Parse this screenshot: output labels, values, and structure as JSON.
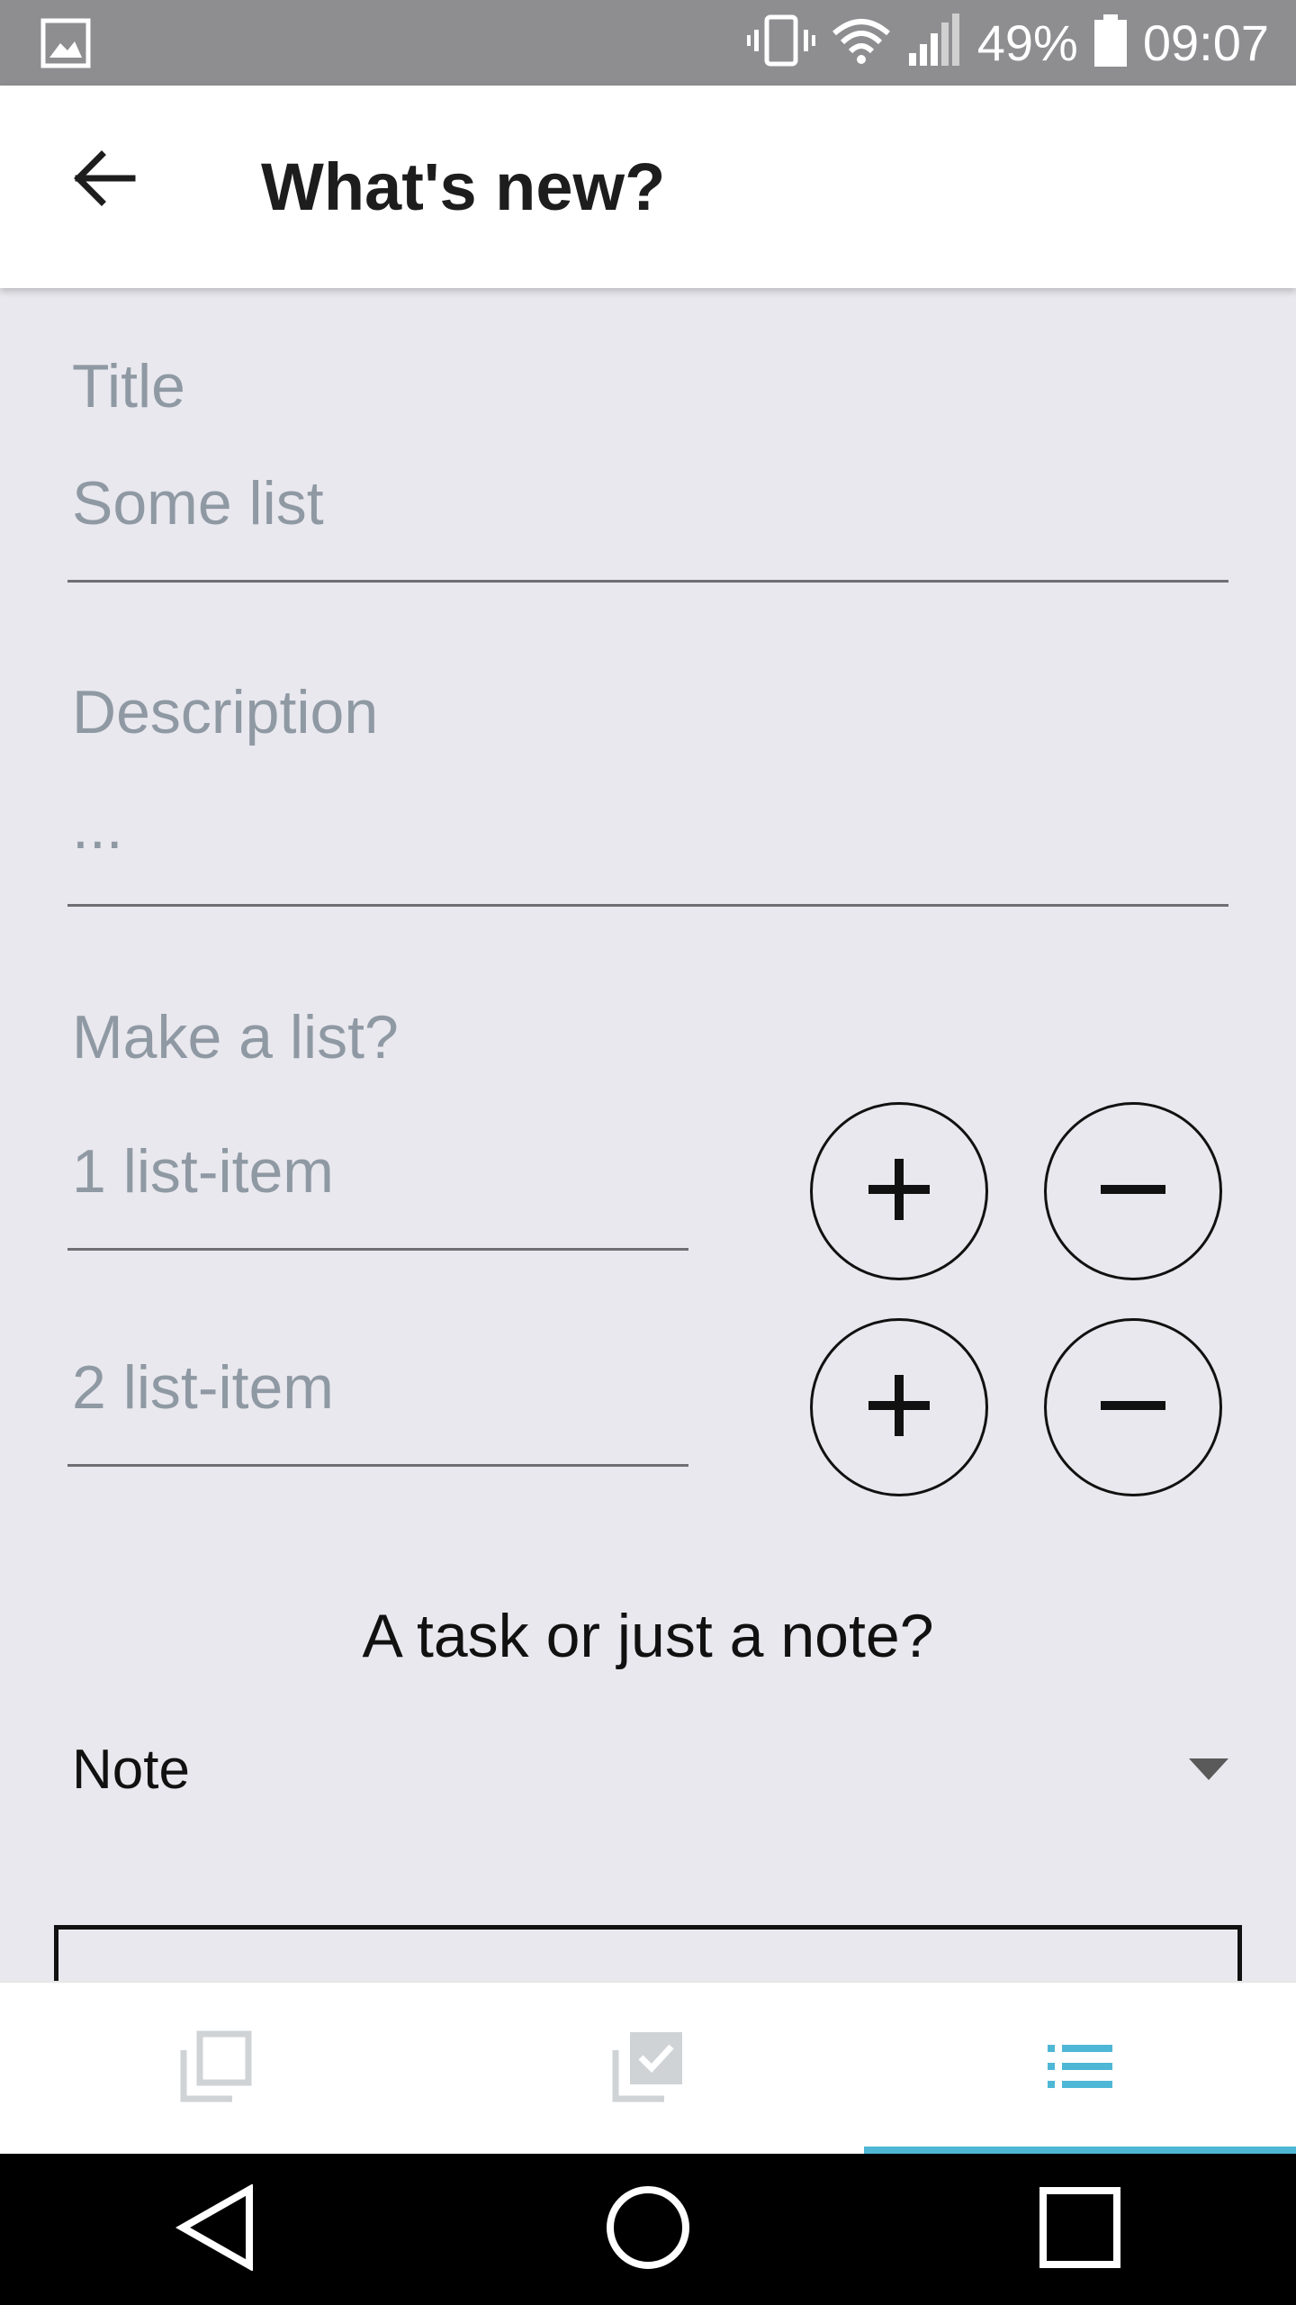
{
  "status_bar": {
    "battery": "49%",
    "time": "09:07",
    "icons": [
      "gallery-icon",
      "vibrate-icon",
      "wifi-icon",
      "signal-icon",
      "battery-icon"
    ]
  },
  "app_bar": {
    "title": "What's new?",
    "back_icon": "arrow-left-icon"
  },
  "form": {
    "title_label": "Title",
    "title_value": "Some list",
    "description_label": "Description",
    "description_value": "...",
    "list_label": "Make a list?",
    "list_items": [
      {
        "placeholder": "1 list-item"
      },
      {
        "placeholder": "2 list-item"
      }
    ],
    "type_question": "A task or just a note?",
    "type_selected": "Note"
  },
  "bottom_tabs": [
    {
      "icon": "copy-icon",
      "active": false
    },
    {
      "icon": "checked-copy-icon",
      "active": false
    },
    {
      "icon": "list-icon",
      "active": true
    }
  ],
  "nav_bar": {
    "icons": [
      "back-triangle-icon",
      "home-circle-icon",
      "recents-square-icon"
    ]
  },
  "colors": {
    "background": "#e9e8ee",
    "status_bar": "#8e8e90",
    "label": "#8f99a3",
    "accent": "#4fb7d6"
  }
}
